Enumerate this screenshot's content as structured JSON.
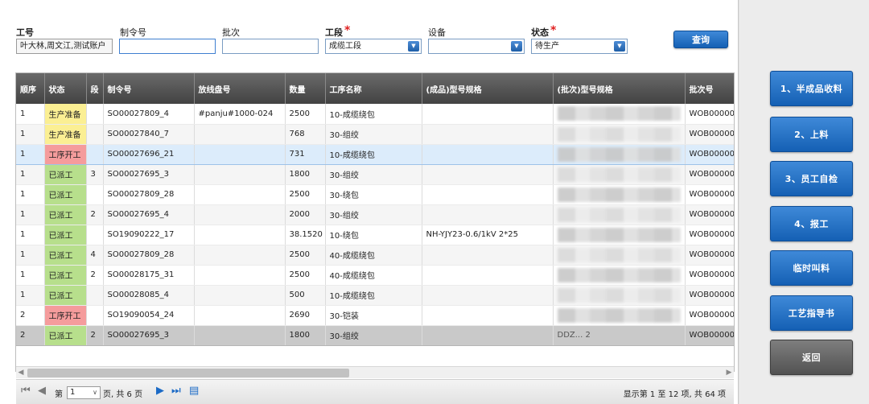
{
  "filters": {
    "worker": {
      "label": "工号",
      "value": "叶大林,周文江,测试账户"
    },
    "order": {
      "label": "制令号",
      "value": ""
    },
    "batch": {
      "label": "批次",
      "value": ""
    },
    "section": {
      "label": "工段",
      "required_mark": "*",
      "value": "成缆工段"
    },
    "equipment": {
      "label": "设备",
      "value": ""
    },
    "status": {
      "label": "状态",
      "required_mark": "*",
      "value": "待生产"
    },
    "query_label": "查询"
  },
  "grid": {
    "columns": [
      "顺序",
      "状态",
      "段",
      "制令号",
      "放线盘号",
      "数量",
      "工序名称",
      "(成品)型号规格",
      "(批次)型号规格",
      "批次号"
    ],
    "rows": [
      {
        "seq": "1",
        "status": "生产准备",
        "status_type": "prep",
        "seg": "",
        "order": "SO00027809_4",
        "reel": "#panju#1000-024",
        "qty": "2500",
        "process": "10-成缆绕包",
        "spec": "",
        "batch": "WOB00000"
      },
      {
        "seq": "1",
        "status": "生产准备",
        "status_type": "prep",
        "seg": "",
        "order": "SO00027840_7",
        "reel": "",
        "qty": "768",
        "process": "30-组绞",
        "spec": "",
        "batch": "WOB00000"
      },
      {
        "seq": "1",
        "status": "工序开工",
        "status_type": "open",
        "seg": "",
        "order": "SO00027696_21",
        "reel": "",
        "qty": "731",
        "process": "10-成缆绕包",
        "spec": "",
        "batch": "WOB00000"
      },
      {
        "seq": "1",
        "status": "已派工",
        "status_type": "disp",
        "seg": "3",
        "order": "SO00027695_3",
        "reel": "",
        "qty": "1800",
        "process": "30-组绞",
        "spec": "",
        "batch": "WOB00000"
      },
      {
        "seq": "1",
        "status": "已派工",
        "status_type": "disp",
        "seg": "",
        "order": "SO00027809_28",
        "reel": "",
        "qty": "2500",
        "process": "30-绕包",
        "spec": "",
        "batch": "WOB00000"
      },
      {
        "seq": "1",
        "status": "已派工",
        "status_type": "disp",
        "seg": "2",
        "order": "SO00027695_4",
        "reel": "",
        "qty": "2000",
        "process": "30-组绞",
        "spec": "",
        "batch": "WOB00000"
      },
      {
        "seq": "1",
        "status": "已派工",
        "status_type": "disp",
        "seg": "",
        "order": "SO19090222_17",
        "reel": "",
        "qty": "38.1520",
        "process": "10-绕包",
        "spec": "NH-YJY23-0.6/1kV 2*25",
        "batch": "WOB00000"
      },
      {
        "seq": "1",
        "status": "已派工",
        "status_type": "disp",
        "seg": "4",
        "order": "SO00027809_28",
        "reel": "",
        "qty": "2500",
        "process": "40-成缆绕包",
        "spec": "",
        "batch": "WOB00000"
      },
      {
        "seq": "1",
        "status": "已派工",
        "status_type": "disp",
        "seg": "2",
        "order": "SO00028175_31",
        "reel": "",
        "qty": "2500",
        "process": "40-成缆绕包",
        "spec": "",
        "batch": "WOB00000"
      },
      {
        "seq": "1",
        "status": "已派工",
        "status_type": "disp",
        "seg": "",
        "order": "SO00028085_4",
        "reel": "",
        "qty": "500",
        "process": "10-成缆绕包",
        "spec": "",
        "batch": "WOB00000"
      },
      {
        "seq": "2",
        "status": "工序开工",
        "status_type": "open",
        "seg": "",
        "order": "SO19090054_24",
        "reel": "",
        "qty": "2690",
        "process": "30-铠装",
        "spec": "",
        "batch": "WOB00000"
      },
      {
        "seq": "2",
        "status": "已派工",
        "status_type": "disp",
        "seg": "2",
        "order": "SO00027695_3",
        "reel": "",
        "qty": "1800",
        "process": "30-组绞",
        "spec": "",
        "batch": "WOB00000",
        "batch_spec_partial": "DDZ... 2"
      }
    ]
  },
  "pager": {
    "prefix": "第",
    "page": "1",
    "suffix": "页, 共 6 页",
    "summary": "显示第 1 至 12 项, 共 64 项"
  },
  "side_buttons": [
    "1、半成品收料",
    "2、上料",
    "3、员工自检",
    "4、报工",
    "临时叫料",
    "工艺指导书",
    "返回"
  ],
  "colors": {
    "status_prep": "#fbef93",
    "status_open": "#f59c9c",
    "status_dispatched": "#b7df8c",
    "button_blue": "#1f6fc4",
    "button_gray": "#616161"
  }
}
